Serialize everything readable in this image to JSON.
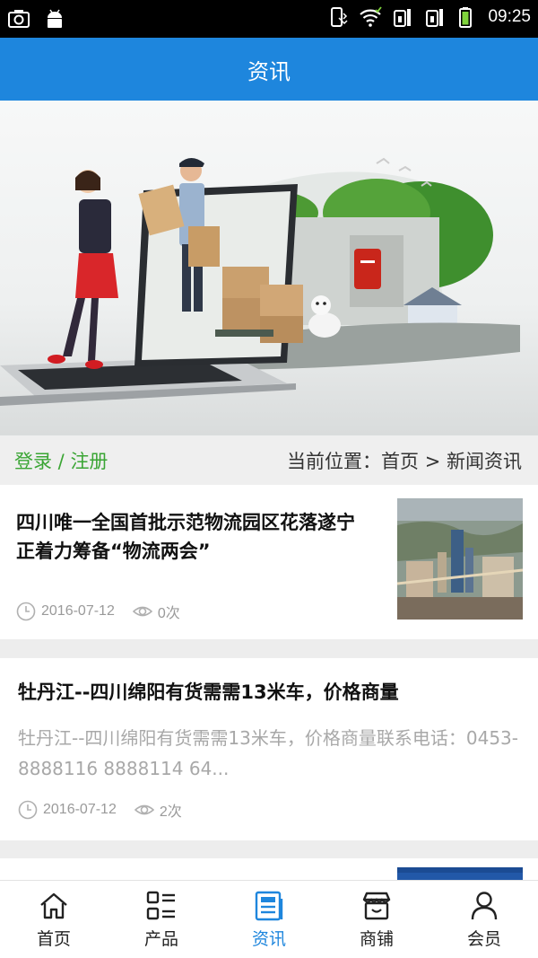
{
  "status_bar": {
    "time": "09:25",
    "icons_left": [
      "screenshot-icon",
      "android-icon"
    ],
    "icons_right": [
      "vibrate-icon",
      "wifi-icon",
      "sim1-icon",
      "sim2-icon",
      "battery-icon"
    ]
  },
  "header": {
    "title": "资讯"
  },
  "location_bar": {
    "login": "登录",
    "separator": " / ",
    "register": "注册",
    "breadcrumb": "当前位置：首页 > 新闻资讯"
  },
  "news": [
    {
      "title": "四川唯一全国首批示范物流园区花落遂宁 正着力筹备“物流两会”",
      "date": "2016-07-12",
      "views": "0次",
      "has_thumbnail": true
    },
    {
      "title": "牡丹江--四川绵阳有货需需13米车，价格商量",
      "description": "牡丹江--四川绵阳有货需需13米车，价格商量联系电话：0453-8888116 8888114 64...",
      "date": "2016-07-12",
      "views": "2次",
      "has_thumbnail": false
    }
  ],
  "bottom_nav": [
    {
      "label": "首页",
      "icon": "home-icon",
      "active": false
    },
    {
      "label": "产品",
      "icon": "product-grid-icon",
      "active": false
    },
    {
      "label": "资讯",
      "icon": "news-icon",
      "active": true
    },
    {
      "label": "商铺",
      "icon": "shop-icon",
      "active": false
    },
    {
      "label": "会员",
      "icon": "member-icon",
      "active": false
    }
  ],
  "colors": {
    "brand": "#1e86dd",
    "login_green": "#3aa534",
    "status_bar": "#000000"
  }
}
